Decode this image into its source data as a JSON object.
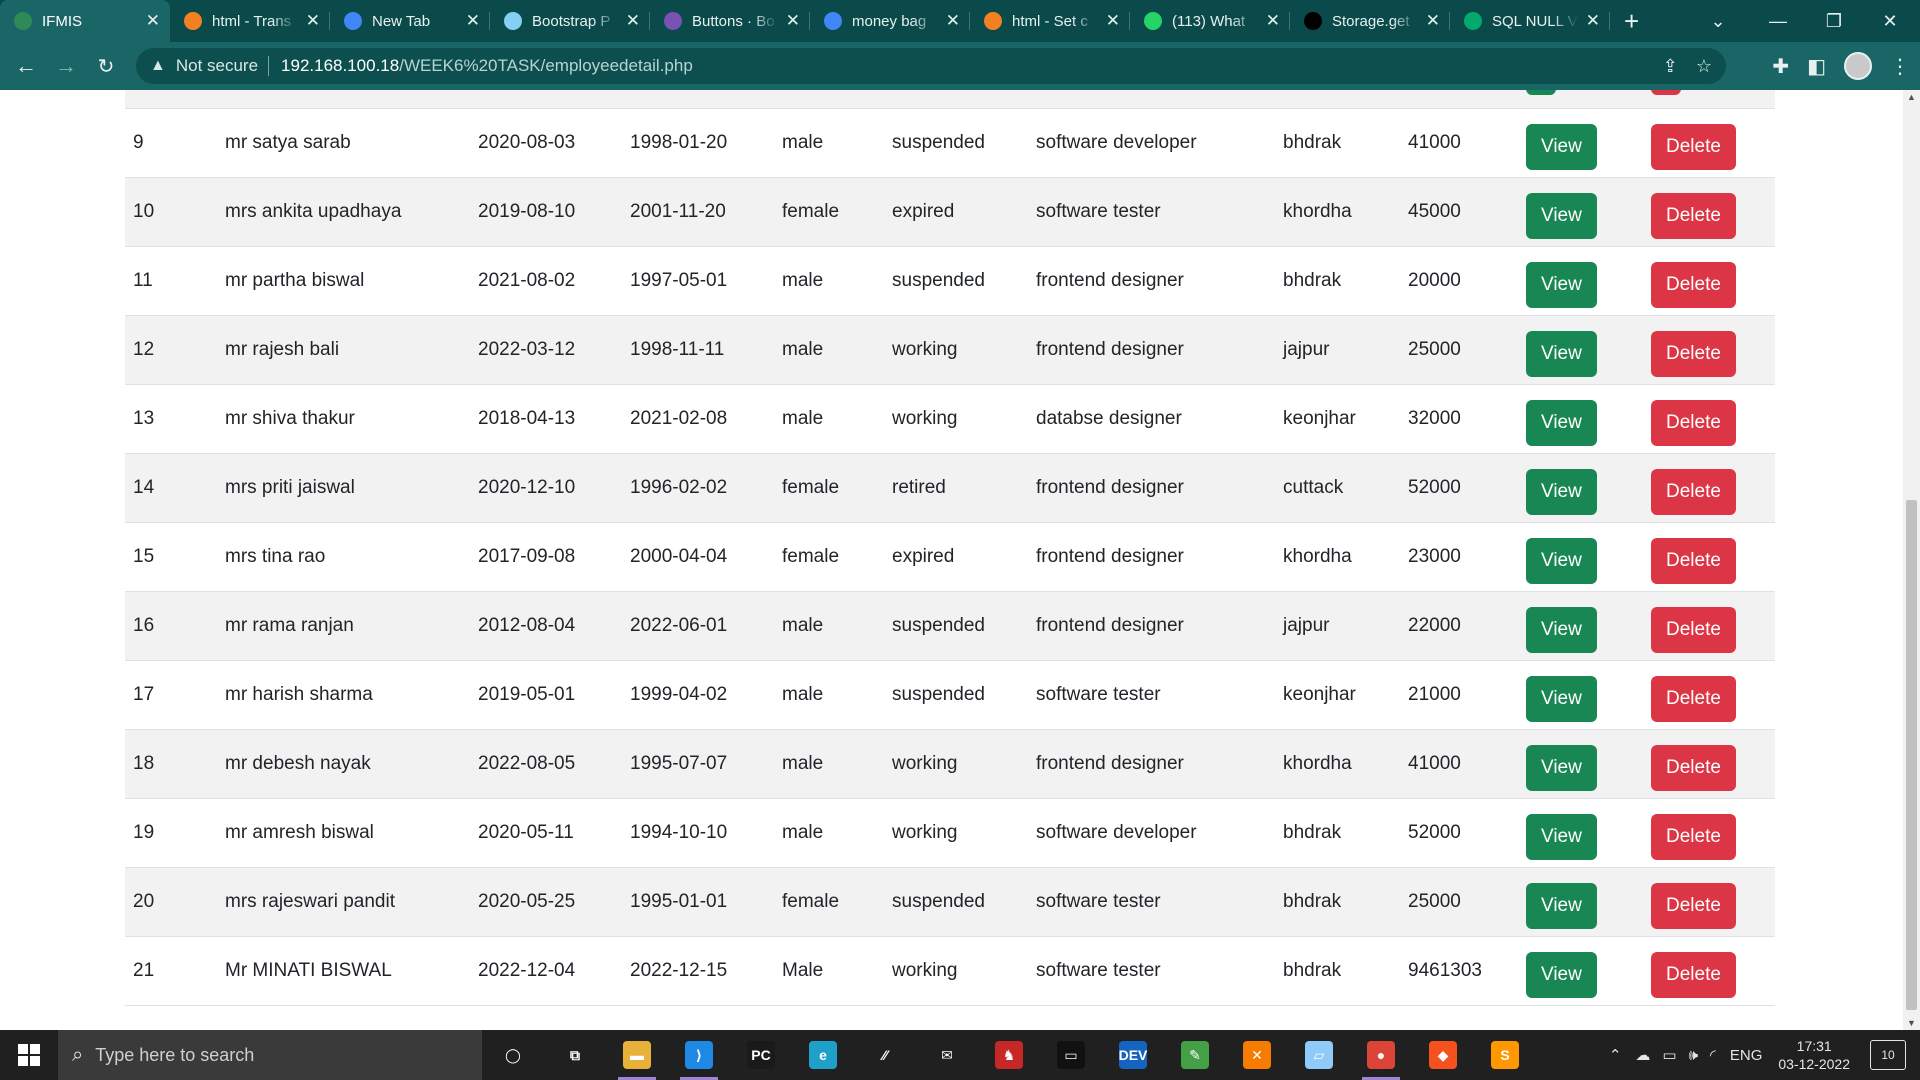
{
  "browser": {
    "tabs": [
      {
        "title": "IFMIS",
        "icon": "globe-icon",
        "color": "#2e8b57",
        "active": true
      },
      {
        "title": "html - Trans",
        "icon": "stackoverflow-icon",
        "color": "#f48024"
      },
      {
        "title": "New Tab",
        "icon": "chrome-icon",
        "color": "#4285f4"
      },
      {
        "title": "Bootstrap P",
        "icon": "mdn-icon",
        "color": "#83d0f2"
      },
      {
        "title": "Buttons · Bo",
        "icon": "bootstrap-icon",
        "color": "#7952b3"
      },
      {
        "title": "money bag",
        "icon": "google-icon",
        "color": "#4285f4"
      },
      {
        "title": "html - Set c",
        "icon": "stackoverflow-icon",
        "color": "#f48024"
      },
      {
        "title": "(113) What",
        "icon": "whatsapp-icon",
        "color": "#25d366"
      },
      {
        "title": "Storage.get",
        "icon": "medium-icon",
        "color": "#000000"
      },
      {
        "title": "SQL NULL V",
        "icon": "w3schools-icon",
        "color": "#04aa6d"
      }
    ],
    "omnibox": {
      "security_label": "Not secure",
      "host": "192.168.100.18",
      "path": "/WEEK6%20TASK/employeedetail.php"
    }
  },
  "table": {
    "view_label": "View",
    "delete_label": "Delete",
    "rows": [
      {
        "id": "9",
        "name": "mr satya sarab",
        "join_date": "2020-08-03",
        "dob": "1998-01-20",
        "gender": "male",
        "status": "suspended",
        "designation": "software developer",
        "location": "bhdrak",
        "salary": "41000"
      },
      {
        "id": "10",
        "name": "mrs ankita upadhaya",
        "join_date": "2019-08-10",
        "dob": "2001-11-20",
        "gender": "female",
        "status": "expired",
        "designation": "software tester",
        "location": "khordha",
        "salary": "45000"
      },
      {
        "id": "11",
        "name": "mr partha biswal",
        "join_date": "2021-08-02",
        "dob": "1997-05-01",
        "gender": "male",
        "status": "suspended",
        "designation": "frontend designer",
        "location": "bhdrak",
        "salary": "20000"
      },
      {
        "id": "12",
        "name": "mr rajesh bali",
        "join_date": "2022-03-12",
        "dob": "1998-11-11",
        "gender": "male",
        "status": "working",
        "designation": "frontend designer",
        "location": "jajpur",
        "salary": "25000"
      },
      {
        "id": "13",
        "name": "mr shiva thakur",
        "join_date": "2018-04-13",
        "dob": "2021-02-08",
        "gender": "male",
        "status": "working",
        "designation": "databse designer",
        "location": "keonjhar",
        "salary": "32000"
      },
      {
        "id": "14",
        "name": "mrs priti jaiswal",
        "join_date": "2020-12-10",
        "dob": "1996-02-02",
        "gender": "female",
        "status": "retired",
        "designation": "frontend designer",
        "location": "cuttack",
        "salary": "52000"
      },
      {
        "id": "15",
        "name": "mrs tina rao",
        "join_date": "2017-09-08",
        "dob": "2000-04-04",
        "gender": "female",
        "status": "expired",
        "designation": "frontend designer",
        "location": "khordha",
        "salary": "23000"
      },
      {
        "id": "16",
        "name": "mr rama ranjan",
        "join_date": "2012-08-04",
        "dob": "2022-06-01",
        "gender": "male",
        "status": "suspended",
        "designation": "frontend designer",
        "location": "jajpur",
        "salary": "22000"
      },
      {
        "id": "17",
        "name": "mr harish sharma",
        "join_date": "2019-05-01",
        "dob": "1999-04-02",
        "gender": "male",
        "status": "suspended",
        "designation": "software tester",
        "location": "keonjhar",
        "salary": "21000"
      },
      {
        "id": "18",
        "name": "mr debesh nayak",
        "join_date": "2022-08-05",
        "dob": "1995-07-07",
        "gender": "male",
        "status": "working",
        "designation": "frontend designer",
        "location": "khordha",
        "salary": "41000"
      },
      {
        "id": "19",
        "name": "mr amresh biswal",
        "join_date": "2020-05-11",
        "dob": "1994-10-10",
        "gender": "male",
        "status": "working",
        "designation": "software developer",
        "location": "bhdrak",
        "salary": "52000"
      },
      {
        "id": "20",
        "name": "mrs rajeswari pandit",
        "join_date": "2020-05-25",
        "dob": "1995-01-01",
        "gender": "female",
        "status": "suspended",
        "designation": "software tester",
        "location": "bhdrak",
        "salary": "25000"
      },
      {
        "id": "21",
        "name": "Mr MINATI BISWAL",
        "join_date": "2022-12-04",
        "dob": "2022-12-15",
        "gender": "Male",
        "status": "working",
        "designation": "software tester",
        "location": "bhdrak",
        "salary": "9461303"
      }
    ]
  },
  "taskbar": {
    "search_placeholder": "Type here to search",
    "language": "ENG",
    "time": "17:31",
    "date": "03-12-2022",
    "notification_count": "10",
    "apps": [
      {
        "name": "cortana-icon",
        "glyph": "◯",
        "color": "transparent"
      },
      {
        "name": "task-view-icon",
        "glyph": "⧉",
        "color": "transparent"
      },
      {
        "name": "file-explorer-icon",
        "glyph": "▬",
        "color": "#e8b23a",
        "running": true
      },
      {
        "name": "vscode-icon",
        "glyph": "⟩",
        "color": "#1e88e5",
        "running": true
      },
      {
        "name": "pycharm-icon",
        "glyph": "PC",
        "color": "#1a1a1a"
      },
      {
        "name": "edge-icon",
        "glyph": "e",
        "color": "#1fa0c9"
      },
      {
        "name": "app-icon",
        "glyph": "⁄⁄",
        "color": "transparent"
      },
      {
        "name": "mail-icon",
        "glyph": "✉",
        "color": "transparent"
      },
      {
        "name": "game-icon",
        "glyph": "♞",
        "color": "#c62828"
      },
      {
        "name": "terminal-icon",
        "glyph": "▭",
        "color": "#111111"
      },
      {
        "name": "dev-icon",
        "glyph": "DEV",
        "color": "#1565c0"
      },
      {
        "name": "notepad-icon",
        "glyph": "✎",
        "color": "#43a047"
      },
      {
        "name": "xampp-icon",
        "glyph": "✕",
        "color": "#f57c00"
      },
      {
        "name": "clipboard-icon",
        "glyph": "▱",
        "color": "#90caf9"
      },
      {
        "name": "chrome-icon",
        "glyph": "●",
        "color": "#db4437",
        "running": true
      },
      {
        "name": "git-icon",
        "glyph": "◆",
        "color": "#f4511e"
      },
      {
        "name": "sublime-icon",
        "glyph": "S",
        "color": "#ff9800"
      }
    ]
  }
}
